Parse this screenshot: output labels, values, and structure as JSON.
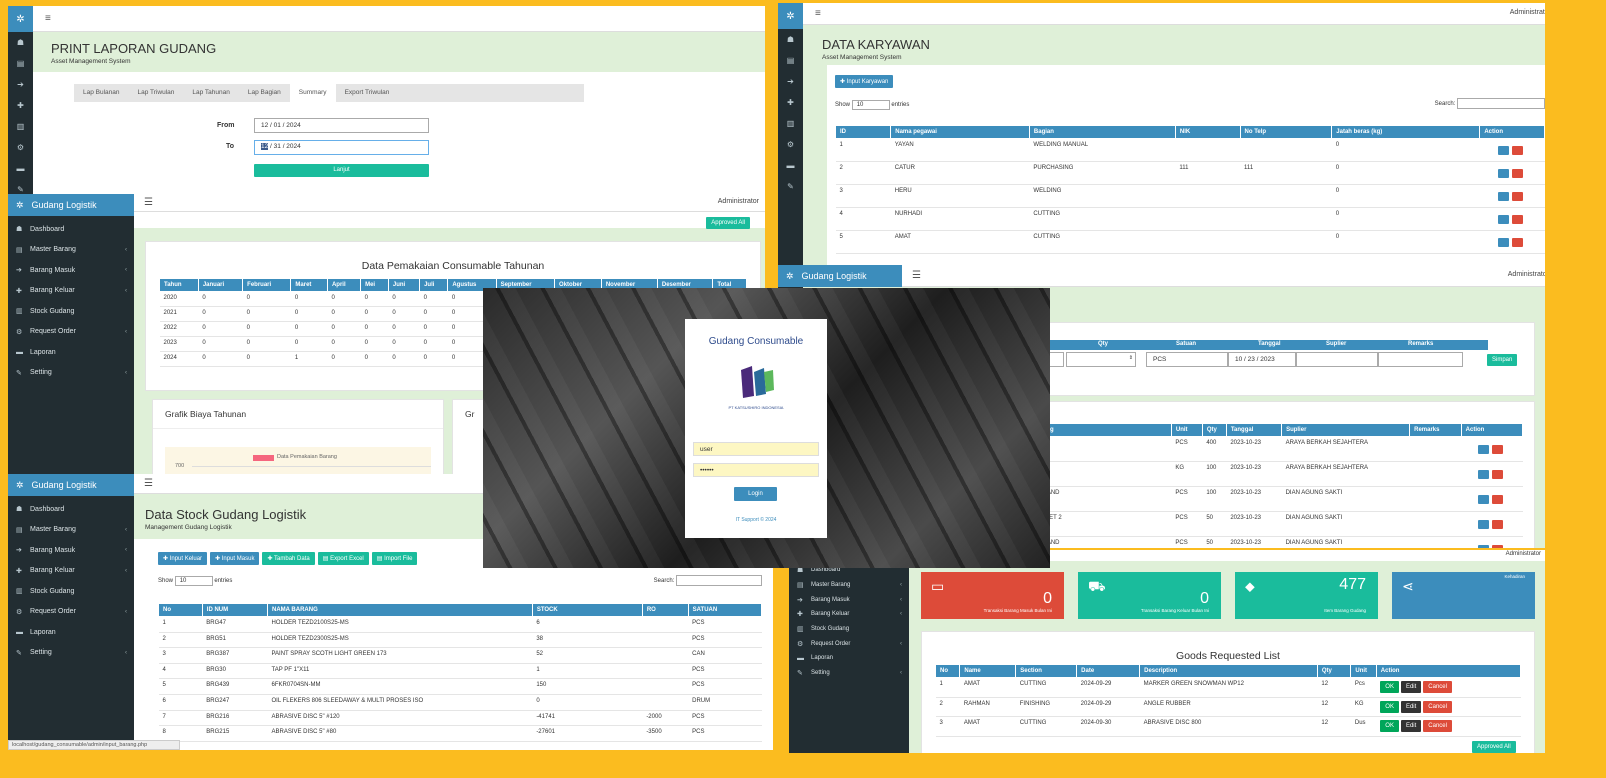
{
  "apps": {
    "brand": "Gudang Logistik",
    "admin": "Administrator",
    "burger": "≡"
  },
  "icons": {
    "logo": "✲",
    "dashboard": "☗",
    "master": "▤",
    "masuk": "➔",
    "keluar": "✚",
    "stock": "▥",
    "request": "⚙",
    "laporan": "▬",
    "setting": "✎",
    "toggle": "☰"
  },
  "sidebar": {
    "items": [
      {
        "label": "Dashboard",
        "icon": "☗",
        "chev": ""
      },
      {
        "label": "Master Barang",
        "icon": "▤",
        "chev": "‹"
      },
      {
        "label": "Barang Masuk",
        "icon": "➔",
        "chev": "‹"
      },
      {
        "label": "Barang Keluar",
        "icon": "✚",
        "chev": "‹"
      },
      {
        "label": "Stock Gudang",
        "icon": "▥",
        "chev": ""
      },
      {
        "label": "Request Order",
        "icon": "⚙",
        "chev": "‹"
      },
      {
        "label": "Laporan",
        "icon": "▬",
        "chev": ""
      },
      {
        "label": "Setting",
        "icon": "✎",
        "chev": "‹"
      }
    ]
  },
  "print": {
    "title": "PRINT LAPORAN GUDANG",
    "subtitle": "Asset Management System",
    "tabs": [
      "Lap Bulanan",
      "Lap Triwulan",
      "Lap Tahunan",
      "Lap Bagian",
      "Summary",
      "Export Triwulan"
    ],
    "from_label": "From",
    "from_value": "12 / 01 / 2024",
    "to_label": "To",
    "to_value": "12 / 31 / 2024",
    "to_sel": "12",
    "to_rest": " / 31 / 2024",
    "button": "Lanjut"
  },
  "usage": {
    "approved": "Approved All",
    "title": "Data Pemakaian Consumable Tahunan",
    "headers": [
      "Tahun",
      "Januari",
      "Februari",
      "Maret",
      "April",
      "Mei",
      "Juni",
      "Juli",
      "Agustus",
      "September",
      "Oktober",
      "November",
      "Desember",
      "Total"
    ],
    "rows": [
      [
        "2020",
        "0",
        "0",
        "0",
        "0",
        "0",
        "0",
        "0",
        "0"
      ],
      [
        "2021",
        "0",
        "0",
        "0",
        "0",
        "0",
        "0",
        "0",
        "0"
      ],
      [
        "2022",
        "0",
        "0",
        "0",
        "0",
        "0",
        "0",
        "0",
        "0"
      ],
      [
        "2023",
        "0",
        "0",
        "0",
        "0",
        "0",
        "0",
        "0",
        "0"
      ],
      [
        "2024",
        "0",
        "0",
        "1",
        "0",
        "0",
        "0",
        "0",
        "0"
      ]
    ],
    "chart_title": "Grafik Biaya Tahunan",
    "chart_title2": "Gr",
    "legend": "Data Pemakaian Barang",
    "tick": "700"
  },
  "karyawan": {
    "title": "DATA KARYAWAN",
    "subtitle": "Asset Management System",
    "input": "✚ Input Karyawan",
    "show": "Show",
    "show_val": "10",
    "entries": "entries",
    "search": "Search:",
    "headers": [
      "ID",
      "Nama pegawai",
      "Bagian",
      "NIK",
      "No Telp",
      "Jatah beras (kg)",
      "Action"
    ],
    "rows": [
      [
        "1",
        "YAYAN",
        "WELDING MANUAL",
        "",
        "",
        "0"
      ],
      [
        "2",
        "CATUR",
        "PURCHASING",
        "111",
        "111",
        "0"
      ],
      [
        "3",
        "HERU",
        "WELDING",
        "",
        "",
        "0"
      ],
      [
        "4",
        "NURHADI",
        "CUTTING",
        "",
        "",
        "0"
      ],
      [
        "5",
        "AMAT",
        "CUTTING",
        "",
        "",
        "0"
      ]
    ]
  },
  "stock": {
    "title": "Data Stock Gudang Logistik",
    "subtitle": "Management Gudang Logistik",
    "buttons": [
      "✚ Input Keluar",
      "✚ Input Masuk",
      "✚ Tambah Data",
      "▤ Export Excel",
      "▤ Import File"
    ],
    "show": "Show",
    "show_val": "10",
    "entries": "entries",
    "search": "Search:",
    "headers": [
      "No",
      "ID NUM",
      "NAMA BARANG",
      "STOCK",
      "RO",
      "SATUAN"
    ],
    "rows": [
      [
        "1",
        "BRG47",
        "HOLDER TEZD2100S25-MS",
        "6",
        "",
        "PCS"
      ],
      [
        "2",
        "BRG51",
        "HOLDER TEZD2300S25-MS",
        "38",
        "",
        "PCS"
      ],
      [
        "3",
        "BRG387",
        "PAINT SPRAY SCOTH LIGHT GREEN 173",
        "52",
        "",
        "CAN"
      ],
      [
        "4",
        "BRG30",
        "TAP PF 1\"X11",
        "1",
        "",
        "PCS"
      ],
      [
        "5",
        "BRG439",
        "6FKR0704SN-MM",
        "150",
        "",
        "PCS"
      ],
      [
        "6",
        "BRG247",
        "OIL FLEKERS 806 SLEEDAWAY & MULTI PROSES ISO",
        "0",
        "",
        "DRUM"
      ],
      [
        "7",
        "BRG216",
        "ABRASIVE DISC 5\" #120",
        "-41741",
        "-2000",
        "PCS"
      ],
      [
        "8",
        "BRG215",
        "ABRASIVE DISC 5\" #80",
        "-27601",
        "-3500",
        "PCS"
      ]
    ],
    "status_url": "localhost/gudang_consumable/admin/input_barang.php"
  },
  "login": {
    "title": "Gudang Consumable",
    "company": "PT KATSUSHIRO INDONESIA",
    "user": "user",
    "pass": "••••••",
    "button": "Login",
    "footer": "IT Support © 2024"
  },
  "masuk": {
    "form_headers": [
      "Qty",
      "Satuan",
      "Tanggal",
      "Suplier",
      "Remarks"
    ],
    "satuan": "PCS",
    "tanggal": "10 / 23 / 2023",
    "simpan": "Simpan",
    "headers": [
      "Barang",
      "Unit",
      "Qty",
      "Tanggal",
      "Suplier",
      "Remarks",
      "Action"
    ],
    "rows": [
      [
        "",
        "PCS",
        "400",
        "2023-10-23",
        "ARAYA BERKAH SEJAHTERA",
        ""
      ],
      [
        "",
        "KG",
        "100",
        "2023-10-23",
        "ARAYA BERKAH SEJAHTERA",
        ""
      ],
      [
        "ER HAND",
        "PCS",
        "100",
        "2023-10-23",
        "DIAN AGUNG SAKTI",
        ""
      ],
      [
        "RACKET 2",
        "PCS",
        "50",
        "2023-10-23",
        "DIAN AGUNG SAKTI",
        ""
      ],
      [
        "ER HAND",
        "PCS",
        "50",
        "2023-10-23",
        "DIAN AGUNG SAKTI",
        ""
      ]
    ]
  },
  "dash": {
    "boxes": [
      {
        "num": "0",
        "label": "Transaksi Barang Masuk Bulan Ini",
        "color": "#dd4b39",
        "icon": "▭"
      },
      {
        "num": "0",
        "label": "Transaksi Barang Keluar Bulan Ini",
        "color": "#1abc9c",
        "icon": "⛟"
      },
      {
        "num": "477",
        "label": "Item Barang Gudang",
        "color": "#1abc9c",
        "icon": "⬥"
      },
      {
        "num": "",
        "label": "Kehadiran",
        "color": "#3c8dbc",
        "icon": "⋖"
      }
    ],
    "title": "Goods Requested List",
    "headers": [
      "No",
      "Name",
      "Section",
      "Date",
      "Description",
      "Qty",
      "Unit",
      "Action"
    ],
    "rows": [
      [
        "1",
        "AMAT",
        "CUTTING",
        "2024-09-29",
        "MARKER GREEN SNOWMAN WP12",
        "12",
        "Pcs"
      ],
      [
        "2",
        "RAHMAN",
        "FINISHING",
        "2024-09-29",
        "ANGLE RUBBER",
        "12",
        "KG"
      ],
      [
        "3",
        "AMAT",
        "CUTTING",
        "2024-09-30",
        "ABRASIVE DISC 800",
        "12",
        "Dus"
      ]
    ],
    "ok": "OK",
    "edit": "Edit",
    "cancel": "Cancel",
    "approved": "Approved All"
  }
}
